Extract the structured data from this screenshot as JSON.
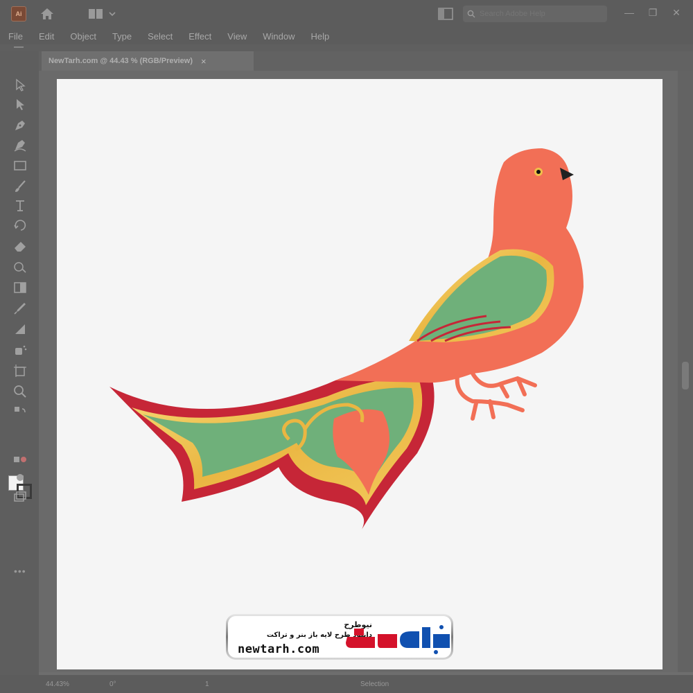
{
  "app": {
    "logo_text": "Ai"
  },
  "search": {
    "placeholder": "Search Adobe Help"
  },
  "window_controls": {
    "minimize": "—",
    "restore": "❐",
    "close": "✕"
  },
  "menu": {
    "items": [
      "File",
      "Edit",
      "Object",
      "Type",
      "Select",
      "Effect",
      "View",
      "Window",
      "Help"
    ]
  },
  "document_tab": {
    "title": "NewTarh.com @ 44.43 % (RGB/Preview)",
    "close": "×"
  },
  "toolbar": {
    "more": "•••"
  },
  "status": {
    "zoom": "44.43%",
    "rotation": "0°",
    "artboard_index": "1",
    "tool": "Selection"
  },
  "watermark": {
    "brand_fa": "نیوطرح",
    "tagline_fa": "دانلود طرح لایه باز بنر و تراکت",
    "domain": "newtarh.com"
  },
  "colors": {
    "body": "#f26f56",
    "wing_green": "#6fb07a",
    "gold": "#f0c04a",
    "crimson": "#c62637",
    "beak": "#222222",
    "artboard": "#f5f5f5",
    "chrome": "#5c5c5c"
  }
}
